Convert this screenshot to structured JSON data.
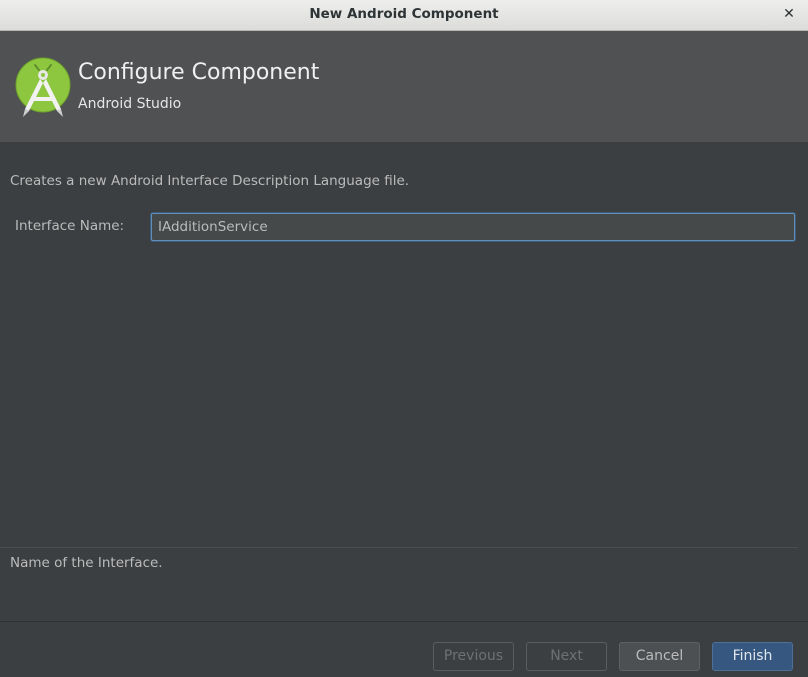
{
  "window": {
    "title": "New Android Component",
    "close_glyph": "✕"
  },
  "header": {
    "title": "Configure Component",
    "subtitle": "Android Studio",
    "logo_icon": "android-studio-logo-icon"
  },
  "body": {
    "description": "Creates a new Android Interface Description Language file.",
    "interface_name_label": "Interface Name:",
    "interface_name_value": "IAdditionService",
    "help_text": "Name of the Interface."
  },
  "buttons": {
    "previous": "Previous",
    "next": "Next",
    "cancel": "Cancel",
    "finish": "Finish"
  },
  "colors": {
    "background": "#3c3f41",
    "header_background": "#4f5153",
    "accent": "#365880",
    "logo_green": "#8dc63f"
  }
}
